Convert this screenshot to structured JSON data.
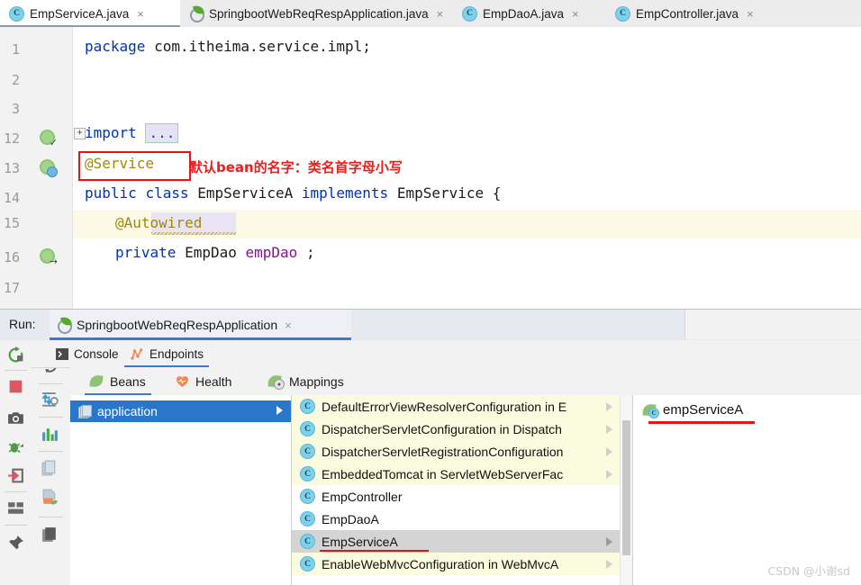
{
  "editor_tabs": [
    {
      "label": "EmpServiceA.java",
      "icon": "class-icon",
      "active": true,
      "close": "×"
    },
    {
      "label": "SpringbootWebReqRespApplication.java",
      "icon": "spring-app-icon",
      "active": false,
      "close": "×"
    },
    {
      "label": "EmpDaoA.java",
      "icon": "class-icon",
      "active": false,
      "close": "×"
    },
    {
      "label": "EmpController.java",
      "icon": "class-icon",
      "active": false,
      "close": "×"
    }
  ],
  "code": {
    "lines": [
      {
        "number": "1",
        "text": "package com.itheima.service.impl;"
      },
      {
        "number": "2",
        "text": ""
      },
      {
        "number": "3",
        "text": "import ..."
      },
      {
        "number": "12",
        "text": "@Service"
      },
      {
        "number": "13",
        "text": "public class EmpServiceA implements EmpService {"
      },
      {
        "number": "14",
        "text": ""
      },
      {
        "number": "15",
        "text": "@Autowired"
      },
      {
        "number": "16",
        "text": "private EmpDao empDao ;"
      },
      {
        "number": "17",
        "text": ""
      }
    ],
    "line1": {
      "kw": "package",
      "rest": " com.itheima.service.impl;"
    },
    "line3": {
      "kw": "import",
      "fold": "..."
    },
    "line12": {
      "annotation": "@Service"
    },
    "line13": {
      "kw1": "public",
      "kw2": "class",
      "name": "EmpServiceA",
      "kw3": "implements",
      "iface": "EmpService",
      "brace": "{"
    },
    "line15": {
      "annotation": "@Autowired"
    },
    "line16": {
      "kw": "private",
      "type": "EmpDao",
      "field": "empDao",
      "semi": ";"
    },
    "annotation_note": "默认bean的名字：类名首字母小写",
    "annotation_note_color": "#ee1c1c",
    "highlight_box_color": "#ee1111"
  },
  "run_window": {
    "label": "Run:",
    "tab": {
      "name": "SpringbootWebReqRespApplication",
      "close": "×",
      "icon": "spring-app-icon"
    },
    "left_toolbar": [
      {
        "name": "rerun-icon",
        "title": "Rerun"
      },
      {
        "name": "stop-icon",
        "title": "Stop"
      },
      {
        "name": "camera-icon",
        "title": "Screenshot"
      },
      {
        "name": "debug-attach-icon",
        "title": "Attach Debugger"
      },
      {
        "name": "exit-arrow-icon",
        "title": "Soft Exit"
      },
      {
        "name": "layout-icon",
        "title": "Layout"
      },
      {
        "name": "pin-icon",
        "title": "Pin Tab"
      }
    ],
    "second_toolbar": [
      {
        "name": "refresh-icon",
        "title": "Refresh"
      },
      {
        "name": "thread-dump-icon",
        "title": "Thread Dump"
      },
      {
        "name": "chart-icon",
        "title": "Metrics"
      },
      {
        "name": "copy-icon",
        "title": "Copy"
      },
      {
        "name": "bean-export-icon",
        "title": "Export Beans"
      },
      {
        "name": "layers-icon",
        "title": "Layers"
      }
    ],
    "tabs": [
      {
        "label": "Console",
        "icon": "console-icon",
        "active": false
      },
      {
        "label": "Endpoints",
        "icon": "endpoints-icon",
        "active": true
      }
    ],
    "subtabs": [
      {
        "label": "Beans",
        "icon": "bean-icon",
        "active": true
      },
      {
        "label": "Health",
        "icon": "heart-icon",
        "active": false
      },
      {
        "label": "Mappings",
        "icon": "mappings-icon",
        "active": false
      }
    ],
    "tree": {
      "selected_node": "application",
      "node_icon": "module-icon"
    },
    "beans": [
      {
        "label": "DefaultErrorViewResolverConfiguration in E",
        "highlighted": true,
        "selected": false,
        "expandable": true
      },
      {
        "label": "DispatcherServletConfiguration in Dispatch",
        "highlighted": true,
        "selected": false,
        "expandable": true
      },
      {
        "label": "DispatcherServletRegistrationConfiguration",
        "highlighted": true,
        "selected": false,
        "expandable": true
      },
      {
        "label": "EmbeddedTomcat in ServletWebServerFac",
        "highlighted": true,
        "selected": false,
        "expandable": true
      },
      {
        "label": "EmpController",
        "highlighted": false,
        "selected": false,
        "expandable": false
      },
      {
        "label": "EmpDaoA",
        "highlighted": false,
        "selected": false,
        "expandable": false
      },
      {
        "label": "EmpServiceA",
        "highlighted": false,
        "selected": true,
        "expandable": true
      },
      {
        "label": "EnableWebMvcConfiguration in WebMvcA",
        "highlighted": true,
        "selected": false,
        "expandable": true
      }
    ],
    "detail": {
      "bean_name": "empServiceA",
      "icon": "bean-class-icon",
      "underline_color": "#ee1111"
    }
  },
  "watermark": "CSDN @小谢sd",
  "colors": {
    "accent_blue": "#3879d9",
    "selection_blue": "#2977c9",
    "highlight_yellow": "#fbfbe0",
    "red_marker": "#ee1111"
  }
}
